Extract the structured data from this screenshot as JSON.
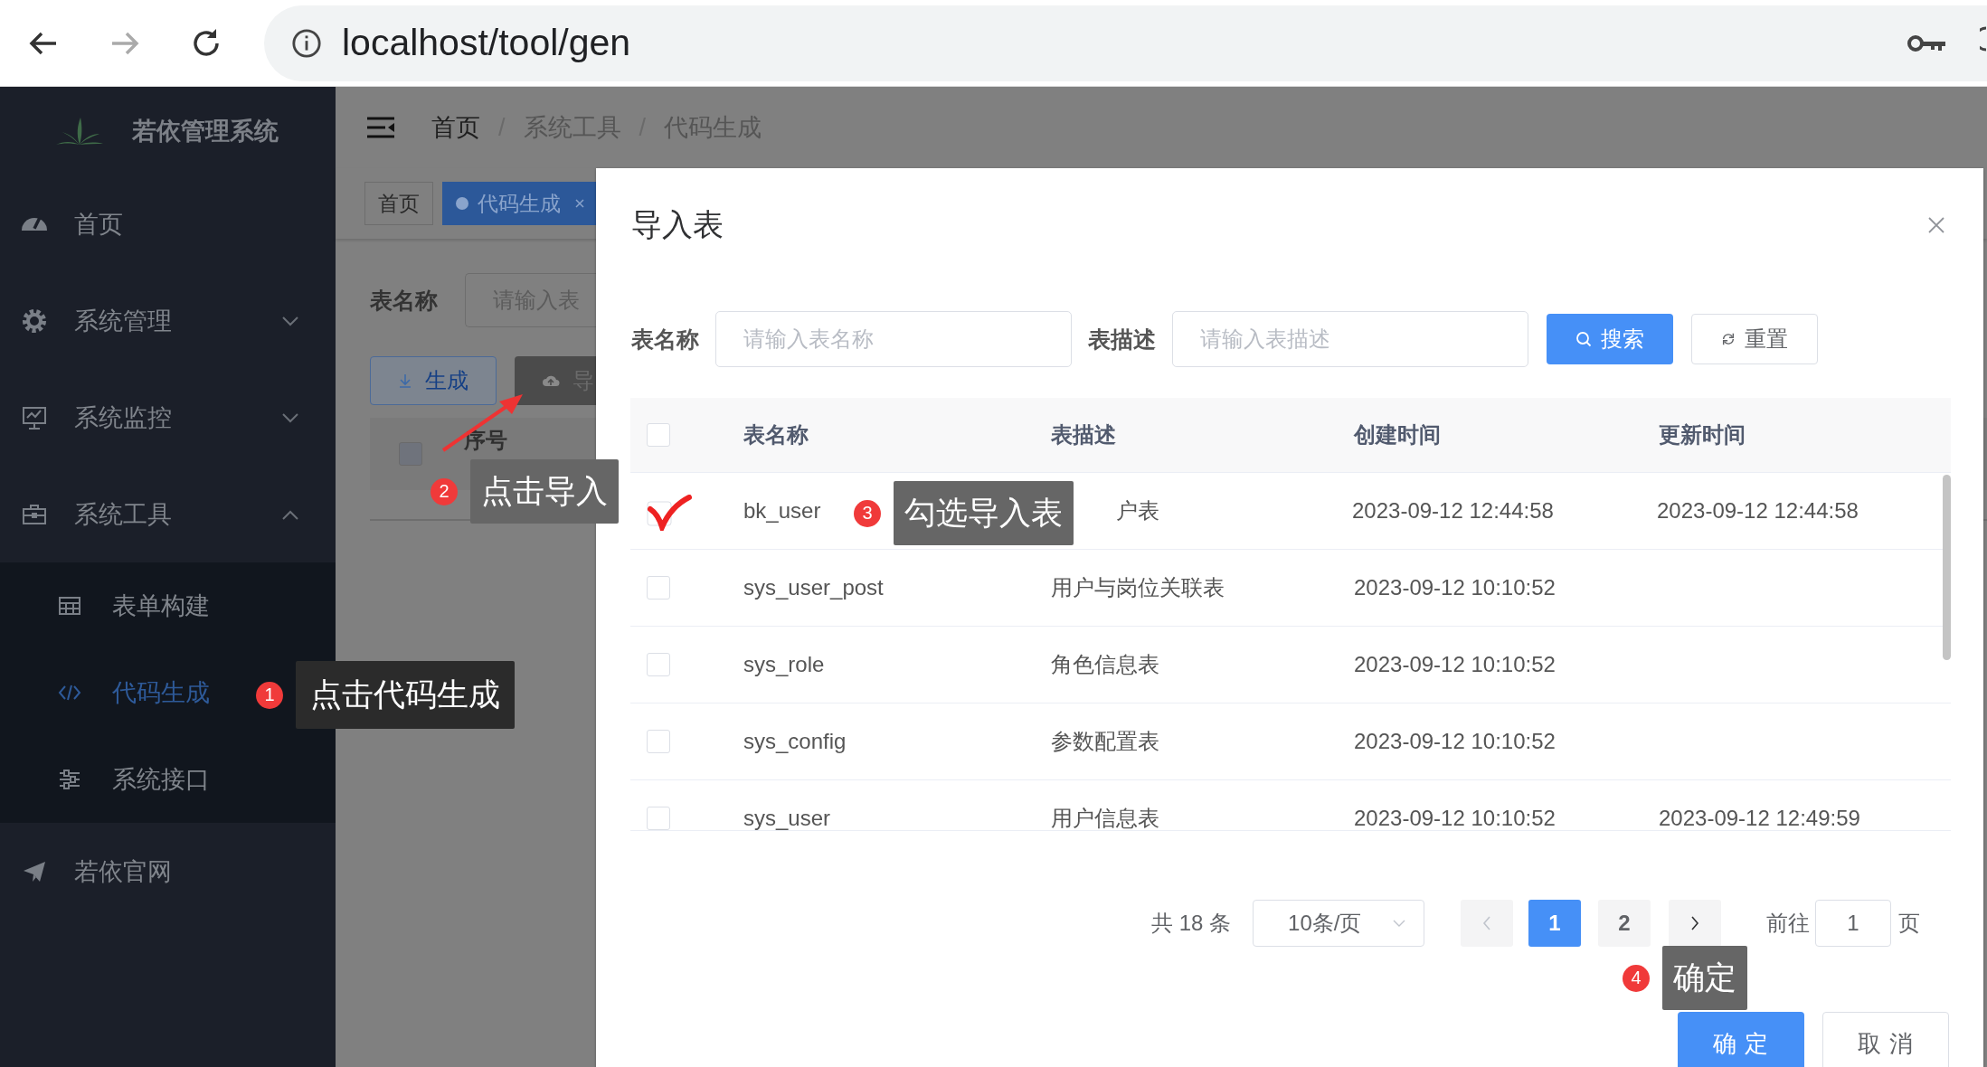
{
  "browser": {
    "url": "localhost/tool/gen"
  },
  "sidebar": {
    "title": "若依管理系统",
    "items": [
      {
        "label": "首页",
        "selected": false
      },
      {
        "label": "系统管理",
        "selected": false,
        "expanded": false
      },
      {
        "label": "系统监控",
        "selected": false,
        "expanded": false
      },
      {
        "label": "系统工具",
        "selected": false,
        "expanded": true,
        "children": [
          {
            "label": "表单构建",
            "selected": false
          },
          {
            "label": "代码生成",
            "selected": true
          },
          {
            "label": "系统接口",
            "selected": false
          }
        ]
      },
      {
        "label": "若依官网",
        "selected": false
      }
    ]
  },
  "navbar": {
    "breadcrumb": [
      "首页",
      "系统工具",
      "代码生成"
    ],
    "separator": "/"
  },
  "tags": [
    {
      "label": "首页",
      "selected": false
    },
    {
      "label": "代码生成",
      "selected": true
    }
  ],
  "page": {
    "filter_label": "表名称",
    "filter_placeholder": "请输入表",
    "buttons": [
      "生成",
      "导"
    ],
    "table_header": "序号",
    "select_all_checked": false
  },
  "dialog": {
    "title": "导入表",
    "filters": [
      {
        "label": "表名称",
        "placeholder": "请输入表名称"
      },
      {
        "label": "表描述",
        "placeholder": "请输入表描述"
      }
    ],
    "search_button": "搜索",
    "reset_button": "重置",
    "table": {
      "select_all_checked": false,
      "columns": [
        "表名称",
        "表描述",
        "创建时间",
        "更新时间"
      ],
      "rows": [
        {
          "checked": true,
          "name": "bk_user",
          "description": "户表",
          "created": "2023-09-12 12:44:58",
          "updated": "2023-09-12 12:44:58"
        },
        {
          "checked": false,
          "name": "sys_user_post",
          "description": "用户与岗位关联表",
          "created": "2023-09-12 10:10:52"
        },
        {
          "checked": false,
          "name": "sys_role",
          "description": "角色信息表",
          "created": "2023-09-12 10:10:52"
        },
        {
          "checked": false,
          "name": "sys_config",
          "description": "参数配置表",
          "created": "2023-09-12 10:10:52"
        },
        {
          "checked": false,
          "name": "sys_user",
          "description": "用户信息表",
          "created": "2023-09-12 10:10:52",
          "updated": "2023-09-12 12:49:59"
        }
      ]
    },
    "pagination": {
      "total": "共 18 条",
      "page_size": "10条/页",
      "pages": [
        {
          "label": "1",
          "selected": true
        },
        {
          "label": "2",
          "selected": false
        }
      ],
      "goto_label": "前往",
      "goto_value": "1",
      "goto_suffix": "页"
    },
    "buttons": [
      {
        "label": "确 定",
        "kind": "primary"
      },
      {
        "label": "取 消",
        "kind": "default"
      }
    ]
  },
  "annotations": [
    {
      "number": "1",
      "text": "点击代码生成"
    },
    {
      "number": "2",
      "text": "点击导入"
    },
    {
      "number": "3",
      "text": "勾选导入表"
    },
    {
      "number": "4",
      "text": "确定"
    }
  ]
}
